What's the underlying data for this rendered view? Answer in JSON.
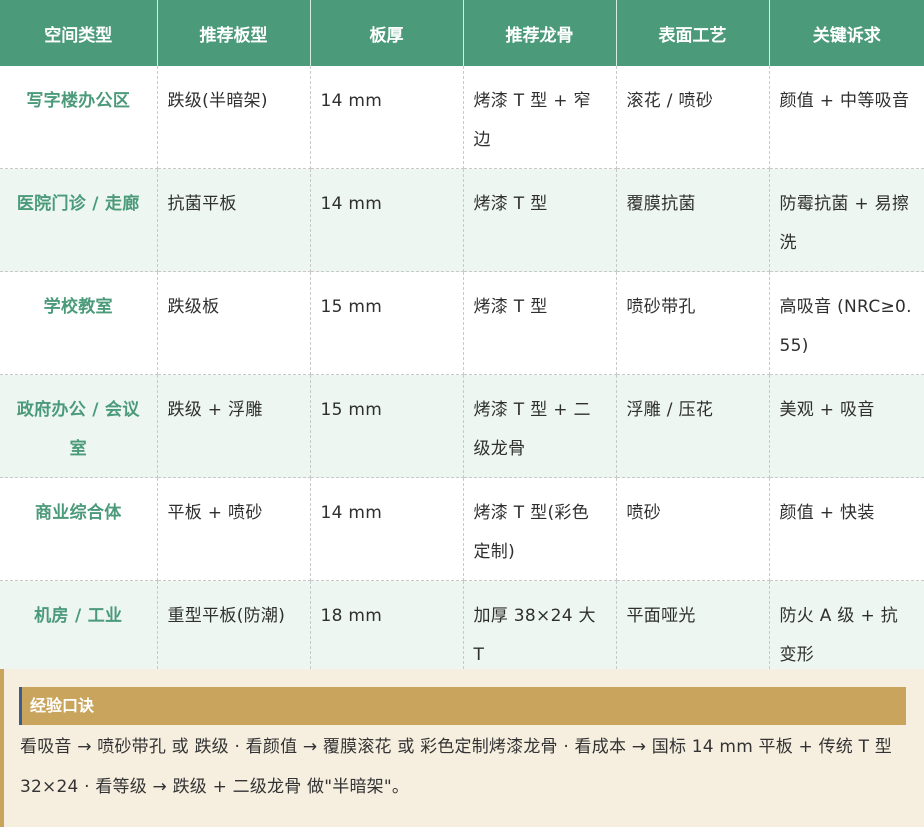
{
  "table": {
    "headers": [
      "空间类型",
      "推荐板型",
      "板厚",
      "推荐龙骨",
      "表面工艺",
      "关键诉求"
    ],
    "rows": [
      [
        "写字楼办公区",
        "跌级(半暗架)",
        "14 mm",
        "烤漆 T 型 + 窄边",
        "滚花 / 喷砂",
        "颜值 + 中等吸音"
      ],
      [
        "医院门诊 / 走廊",
        "抗菌平板",
        "14 mm",
        "烤漆 T 型",
        "覆膜抗菌",
        "防霉抗菌 + 易擦洗"
      ],
      [
        "学校教室",
        "跌级板",
        "15 mm",
        "烤漆 T 型",
        "喷砂带孔",
        "高吸音 (NRC≥0.55)"
      ],
      [
        "政府办公 / 会议室",
        "跌级 + 浮雕",
        "15 mm",
        "烤漆 T 型 + 二级龙骨",
        "浮雕 / 压花",
        "美观 + 吸音"
      ],
      [
        "商业综合体",
        "平板 + 喷砂",
        "14 mm",
        "烤漆 T 型(彩色定制)",
        "喷砂",
        "颜值 + 快装"
      ],
      [
        "机房 / 工业",
        "重型平板(防潮)",
        "18 mm",
        "加厚 38×24 大 T",
        "平面哑光",
        "防火 A 级 + 抗变形"
      ]
    ]
  },
  "tip": {
    "title": "经验口诀",
    "text": "看吸音 → 喷砂带孔 或 跌级  ·  看颜值 → 覆膜滚花 或 彩色定制烤漆龙骨  ·  看成本 → 国标 14 mm 平板 + 传统 T 型 32×24  ·  看等级 → 跌级 + 二级龙骨 做\"半暗架\"。"
  },
  "colors": {
    "header_bg": "#4b9a7a",
    "accent_text": "#4b9a7a",
    "alt_row_bg": "#edf6f1",
    "tip_bg": "#f6efe0",
    "tip_head_bg": "#c9a45c"
  }
}
